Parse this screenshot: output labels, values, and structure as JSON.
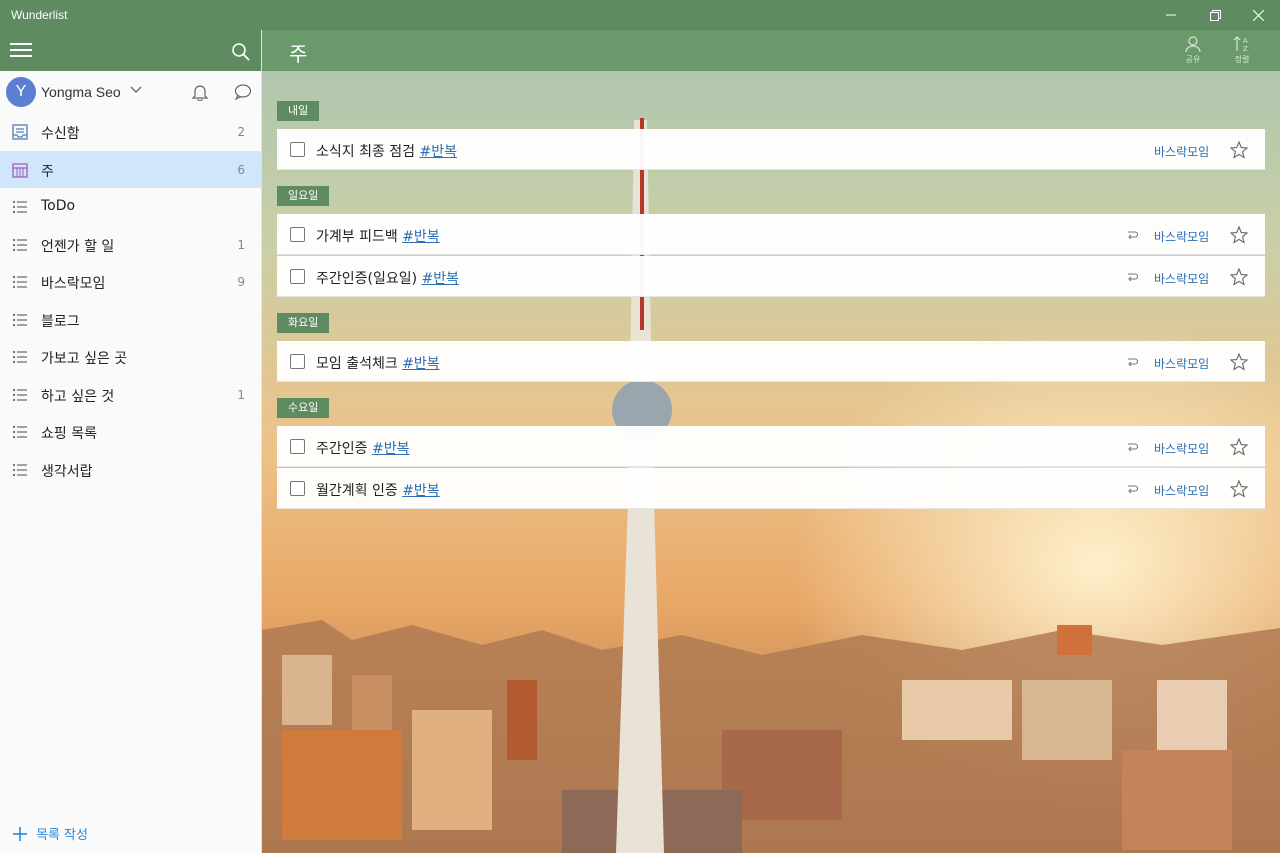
{
  "window": {
    "title": "Wunderlist"
  },
  "user": {
    "initial": "Y",
    "name": "Yongma Seo"
  },
  "lists": [
    {
      "label": "수신함",
      "count": "2",
      "icon": "inbox-icon"
    },
    {
      "label": "주",
      "count": "6",
      "icon": "calendar-week-icon",
      "active": true
    },
    {
      "label": "ToDo",
      "count": "",
      "icon": "list-icon"
    },
    {
      "label": "언젠가 할 일",
      "count": "1",
      "icon": "list-icon"
    },
    {
      "label": "바스락모임",
      "count": "9",
      "icon": "list-icon"
    },
    {
      "label": "블로그",
      "count": "",
      "icon": "list-icon"
    },
    {
      "label": "가보고 싶은 곳",
      "count": "",
      "icon": "list-icon"
    },
    {
      "label": "하고 싶은 것",
      "count": "1",
      "icon": "list-icon"
    },
    {
      "label": "쇼핑 목록",
      "count": "",
      "icon": "list-icon"
    },
    {
      "label": "생각서랍",
      "count": "",
      "icon": "list-icon"
    }
  ],
  "create_list_label": "목록 작성",
  "main": {
    "title": "주",
    "share_label": "공유",
    "sort_label": "정렬"
  },
  "sections": [
    {
      "label": "내일",
      "tasks": [
        {
          "title": "소식지 최종 점검",
          "tag": "#반복",
          "list": "바스락모임",
          "repeat": false
        }
      ]
    },
    {
      "label": "일요일",
      "tasks": [
        {
          "title": "가계부 피드백",
          "tag": "#반복",
          "list": "바스락모임",
          "repeat": true
        },
        {
          "title": "주간인증(일요일)",
          "tag": "#반복",
          "list": "바스락모임",
          "repeat": true
        }
      ]
    },
    {
      "label": "화요일",
      "tasks": [
        {
          "title": "모임 출석체크",
          "tag": "#반복",
          "list": "바스락모임",
          "repeat": true
        }
      ]
    },
    {
      "label": "수요일",
      "tasks": [
        {
          "title": "주간인증",
          "tag": "#반복",
          "list": "바스락모임",
          "repeat": true
        },
        {
          "title": "월간계획 인증",
          "tag": "#반복",
          "list": "바스락모임",
          "repeat": true
        }
      ]
    }
  ],
  "colors": {
    "brand_green": "#5f8b61",
    "active_item": "#cfe6fb",
    "link_blue": "#2b6fb4"
  }
}
